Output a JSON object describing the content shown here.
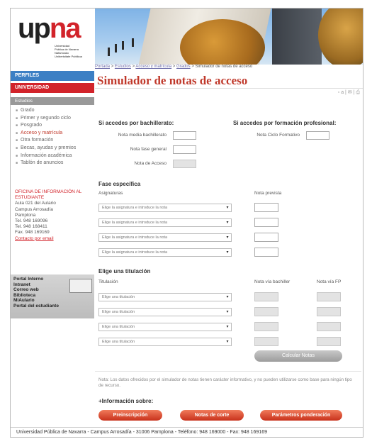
{
  "logo": {
    "up": "up",
    "na": "na",
    "line1": "Universidad",
    "line2": "Pública de Navarra",
    "line3": "Nafarroako",
    "line4": "Unibertsitate Publikoa"
  },
  "breadcrumb": {
    "items": [
      "Portada",
      "Estudios",
      "Acceso y matrícula",
      "Grados"
    ],
    "sep": ">",
    "current": "Simulador de notas de acceso"
  },
  "page_title": "Simulador de notas de acceso",
  "tools": "▫ a | ✉ | ⎙",
  "sidebar": {
    "perfiles": "PERFILES",
    "universidad": "UNIVERSIDAD",
    "estudios": "Estudios",
    "items": [
      {
        "label": "Grado",
        "active": false
      },
      {
        "label": "Primer y segundo ciclo",
        "active": false
      },
      {
        "label": "Posgrado",
        "active": false
      },
      {
        "label": "Acceso y matrícula",
        "active": true
      },
      {
        "label": "Otra formación",
        "active": false
      },
      {
        "label": "Becas, ayudas y premios",
        "active": false
      },
      {
        "label": "Información académica",
        "active": false
      },
      {
        "label": "Tablón de anuncios",
        "active": false
      }
    ],
    "office": {
      "title": "OFICINA DE INFORMACIÓN AL ESTUDIANTE",
      "lines": [
        "Aula 021 del Aulario",
        "Campus Arrosadía",
        "Pamplona",
        "Tel. 948 169096",
        "Tel. 948 168411",
        "Fax. 948 169169"
      ],
      "link": "Contacto por email"
    },
    "portal": [
      "Portal Interno",
      "Intranet",
      "Correo web",
      "Biblioteca",
      "MiAulario",
      "Portal del estudiante"
    ]
  },
  "form": {
    "bach_heading": "Si accedes por bachillerato:",
    "fp_heading": "Si accedes por formación profesional:",
    "nota_media": "Nota media bachillerato",
    "nota_fase_general": "Nota fase general",
    "nota_acceso": "Nota de Acceso",
    "nota_ciclo": "Nota Ciclo Formativo",
    "fase_heading": "Fase específica",
    "col_asignaturas": "Asignaturas",
    "col_nota_prevista": "Nota prevista",
    "asig_placeholder": "Elige la asignatura e introduce la nota",
    "titulacion_heading": "Elige una titulación",
    "col_titulacion": "Titulación",
    "col_via_bach": "Nota vía bachiller",
    "col_via_fp": "Nota vía FP",
    "tit_placeholder": "Elige una titulación",
    "calc_button": "Calcular Notas"
  },
  "note": "Nota: Los datos ofrecidos por el simulador de notas tienen carácter informativo, y no pueden utilizarse como base para ningún tipo de recurso.",
  "info_heading": "+Información sobre:",
  "buttons": {
    "preinscripcion": "Preinscripción",
    "notas_corte": "Notas de corte",
    "parametros": "Parámetros ponderación"
  },
  "footer": "Universidad Pública de Navarra - Campus Arrosadía - 31006 Pamplona - Teléfono: 948 169000 - Fax: 948 169169"
}
